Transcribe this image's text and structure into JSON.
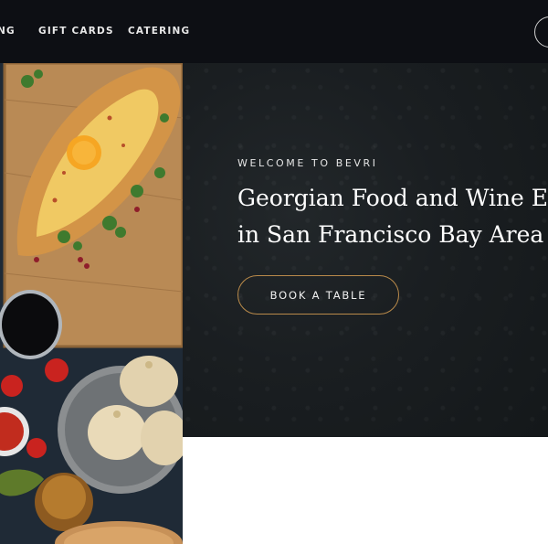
{
  "nav": {
    "partial_item": "NG",
    "gift_cards": "GIFT CARDS",
    "catering": "CATERING"
  },
  "hero": {
    "eyebrow": "WELCOME TO BEVRI",
    "headline_line1": "Georgian Food and Wine Ex",
    "headline_line2": "in San Francisco Bay Area",
    "cta_label": "BOOK A TABLE"
  },
  "colors": {
    "nav_bg": "#0d0f14",
    "hero_bg": "#1a1e21",
    "cta_border": "#b98a4a"
  },
  "icons": {
    "nav_right": "circle-icon"
  }
}
